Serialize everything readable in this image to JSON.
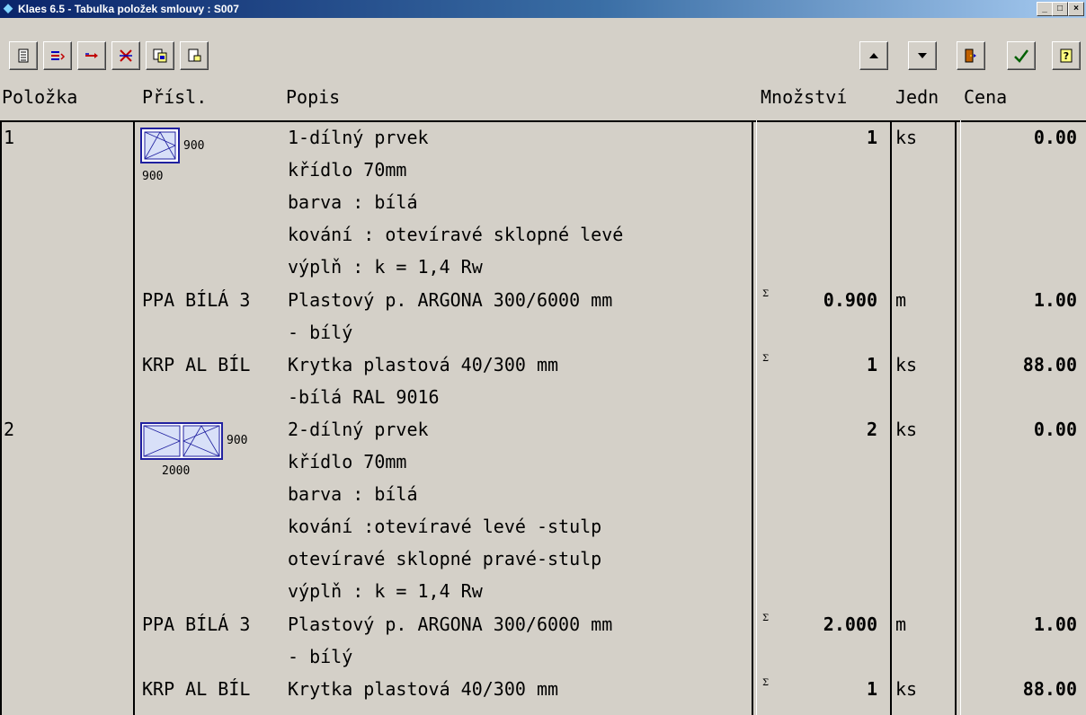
{
  "window": {
    "title": "Klaes 6.5 - Tabulka položek smlouvy  : S007",
    "minimize": "_",
    "maximize": "□",
    "close": "×"
  },
  "toolbar": {
    "left_icons": [
      "list-icon",
      "insert-lines-icon",
      "move-arrow-icon",
      "delete-x-icon",
      "copy-icon",
      "paste-icon"
    ],
    "right_icons": [
      "arrow-up-icon",
      "arrow-down-icon",
      "exit-door-icon",
      "checkmark-icon",
      "help-icon"
    ],
    "colors": {
      "red": "#c00000",
      "blue": "#0000c0",
      "green": "#006000"
    }
  },
  "columns": {
    "polozka": "Položka",
    "prisl": "Přísl.",
    "popis": "Popis",
    "mnozstvi": "Množství",
    "jedn": "Jedn",
    "cena": "Cena"
  },
  "rows": [
    {
      "polozka": "1",
      "prisl": "",
      "popis": "1-dílný prvek",
      "mnozstvi": "1",
      "jedn": "ks",
      "cena": "0.00",
      "sigma": ""
    },
    {
      "polozka": "",
      "prisl": "",
      "popis": "křídlo 70mm",
      "mnozstvi": "",
      "jedn": "",
      "cena": "",
      "sigma": ""
    },
    {
      "polozka": "",
      "prisl": "",
      "popis": "barva  : bílá",
      "mnozstvi": "",
      "jedn": "",
      "cena": "",
      "sigma": ""
    },
    {
      "polozka": "",
      "prisl": "",
      "popis": "kování : otevíravé sklopné levé",
      "mnozstvi": "",
      "jedn": "",
      "cena": "",
      "sigma": ""
    },
    {
      "polozka": "",
      "prisl": "",
      "popis": "výplň  : k = 1,4 Rw",
      "mnozstvi": "",
      "jedn": "",
      "cena": "",
      "sigma": ""
    },
    {
      "polozka": "",
      "prisl": "PPA BÍLÁ 3",
      "popis": "Plastový p. ARGONA 300/6000 mm",
      "mnozstvi": "0.900",
      "jedn": "m",
      "cena": "1.00",
      "sigma": "Σ"
    },
    {
      "polozka": "",
      "prisl": "",
      "popis": "- bílý",
      "mnozstvi": "",
      "jedn": "",
      "cena": "",
      "sigma": ""
    },
    {
      "polozka": "",
      "prisl": "KRP AL BÍL",
      "popis": "Krytka plastová 40/300 mm",
      "mnozstvi": "1",
      "jedn": "ks",
      "cena": "88.00",
      "sigma": "Σ"
    },
    {
      "polozka": "",
      "prisl": "",
      "popis": "-bílá RAL 9016",
      "mnozstvi": "",
      "jedn": "",
      "cena": "",
      "sigma": ""
    },
    {
      "polozka": "2",
      "prisl": "",
      "popis": "2-dílný prvek",
      "mnozstvi": "2",
      "jedn": "ks",
      "cena": "0.00",
      "sigma": ""
    },
    {
      "polozka": "",
      "prisl": "",
      "popis": "křídlo 70mm",
      "mnozstvi": "",
      "jedn": "",
      "cena": "",
      "sigma": ""
    },
    {
      "polozka": "",
      "prisl": "",
      "popis": "barva  : bílá",
      "mnozstvi": "",
      "jedn": "",
      "cena": "",
      "sigma": ""
    },
    {
      "polozka": "",
      "prisl": "",
      "popis": "kování :otevíravé levé -stulp",
      "mnozstvi": "",
      "jedn": "",
      "cena": "",
      "sigma": ""
    },
    {
      "polozka": "",
      "prisl": "",
      "popis": "otevíravé sklopné pravé-stulp",
      "mnozstvi": "",
      "jedn": "",
      "cena": "",
      "sigma": ""
    },
    {
      "polozka": "",
      "prisl": "",
      "popis": "výplň  : k = 1,4 Rw",
      "mnozstvi": "",
      "jedn": "",
      "cena": "",
      "sigma": ""
    },
    {
      "polozka": "",
      "prisl": "PPA BÍLÁ 3",
      "popis": "Plastový p. ARGONA 300/6000 mm",
      "mnozstvi": "2.000",
      "jedn": "m",
      "cena": "1.00",
      "sigma": "Σ"
    },
    {
      "polozka": "",
      "prisl": "",
      "popis": "- bílý",
      "mnozstvi": "",
      "jedn": "",
      "cena": "",
      "sigma": ""
    },
    {
      "polozka": "",
      "prisl": "KRP AL BÍL",
      "popis": "Krytka plastová 40/300 mm",
      "mnozstvi": "1",
      "jedn": "ks",
      "cena": "88.00",
      "sigma": "Σ"
    }
  ],
  "thumbnails": [
    {
      "width_label": "900",
      "height_label": "900"
    },
    {
      "width_label": "900",
      "height_label": "2000"
    }
  ]
}
